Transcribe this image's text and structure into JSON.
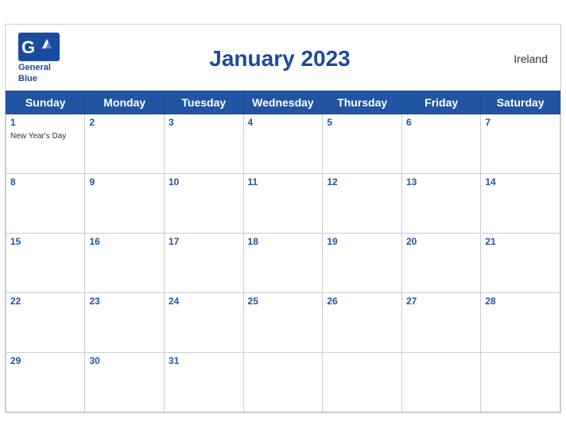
{
  "header": {
    "title": "January 2023",
    "country": "Ireland",
    "logo_line1": "General",
    "logo_line2": "Blue"
  },
  "days_of_week": [
    "Sunday",
    "Monday",
    "Tuesday",
    "Wednesday",
    "Thursday",
    "Friday",
    "Saturday"
  ],
  "weeks": [
    [
      {
        "num": "1",
        "event": "New Year's Day"
      },
      {
        "num": "2",
        "event": ""
      },
      {
        "num": "3",
        "event": ""
      },
      {
        "num": "4",
        "event": ""
      },
      {
        "num": "5",
        "event": ""
      },
      {
        "num": "6",
        "event": ""
      },
      {
        "num": "7",
        "event": ""
      }
    ],
    [
      {
        "num": "8",
        "event": ""
      },
      {
        "num": "9",
        "event": ""
      },
      {
        "num": "10",
        "event": ""
      },
      {
        "num": "11",
        "event": ""
      },
      {
        "num": "12",
        "event": ""
      },
      {
        "num": "13",
        "event": ""
      },
      {
        "num": "14",
        "event": ""
      }
    ],
    [
      {
        "num": "15",
        "event": ""
      },
      {
        "num": "16",
        "event": ""
      },
      {
        "num": "17",
        "event": ""
      },
      {
        "num": "18",
        "event": ""
      },
      {
        "num": "19",
        "event": ""
      },
      {
        "num": "20",
        "event": ""
      },
      {
        "num": "21",
        "event": ""
      }
    ],
    [
      {
        "num": "22",
        "event": ""
      },
      {
        "num": "23",
        "event": ""
      },
      {
        "num": "24",
        "event": ""
      },
      {
        "num": "25",
        "event": ""
      },
      {
        "num": "26",
        "event": ""
      },
      {
        "num": "27",
        "event": ""
      },
      {
        "num": "28",
        "event": ""
      }
    ],
    [
      {
        "num": "29",
        "event": ""
      },
      {
        "num": "30",
        "event": ""
      },
      {
        "num": "31",
        "event": ""
      },
      {
        "num": "",
        "event": ""
      },
      {
        "num": "",
        "event": ""
      },
      {
        "num": "",
        "event": ""
      },
      {
        "num": "",
        "event": ""
      }
    ]
  ]
}
